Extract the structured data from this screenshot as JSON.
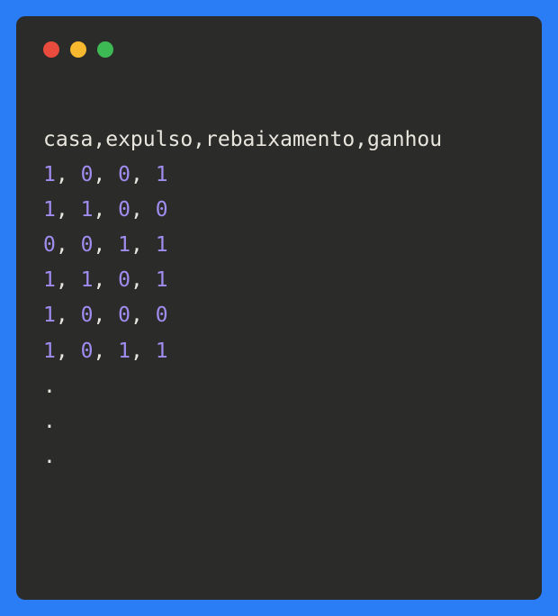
{
  "header": "casa,expulso,rebaixamento,ganhou",
  "rows": [
    [
      1,
      0,
      0,
      1
    ],
    [
      1,
      1,
      0,
      0
    ],
    [
      0,
      0,
      1,
      1
    ],
    [
      1,
      1,
      0,
      1
    ],
    [
      1,
      0,
      0,
      0
    ],
    [
      1,
      0,
      1,
      1
    ]
  ],
  "continuation": [
    ".",
    ".",
    "."
  ]
}
